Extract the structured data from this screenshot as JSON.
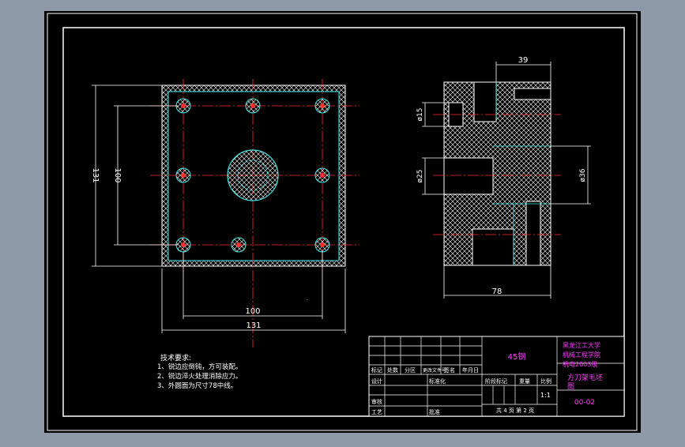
{
  "colors": {
    "viewport_bg": "#8e9aa8",
    "sheet": "#000000",
    "line": "#ffffff",
    "center_line": "#ff2a2a",
    "hidden_line": "#3fe6e6",
    "magenta": "#ff3cff",
    "hole": "#ff3030"
  },
  "dimensions": {
    "front_width_outer": "131",
    "front_width_holes": "100",
    "front_height_outer": "131",
    "front_height_holes": "100",
    "side_top_width": "39",
    "side_bottom_width": "78",
    "dia_small": "ø15",
    "dia_bore": "ø25",
    "dia_outer": "ø36"
  },
  "notes": {
    "title": "技术要求:",
    "items": [
      "1、锐边应倒钝，方可装配。",
      "2、锐边淬火处理消除应力。",
      "3、外圆面为尺寸78中线。"
    ]
  },
  "title_block": {
    "material": "45钢",
    "school_lines": [
      "黑龙江工大学",
      "机械工程学院",
      "机电2003级"
    ],
    "drawing_name_lines": [
      "方刀架毛坯",
      "图"
    ],
    "drawing_number": "00-02",
    "scale": "1:1",
    "sheet_info": "共 4 页 第 2 页",
    "col_labels": [
      "标记",
      "处数",
      "分区",
      "更改文件号",
      "签名",
      "年月日"
    ],
    "design": "设计",
    "check": "审核",
    "process": "工艺",
    "standardize": "标准化",
    "approve": "批准",
    "stage_mark": "阶段标记",
    "weight": "重量",
    "ratio": "比例"
  }
}
